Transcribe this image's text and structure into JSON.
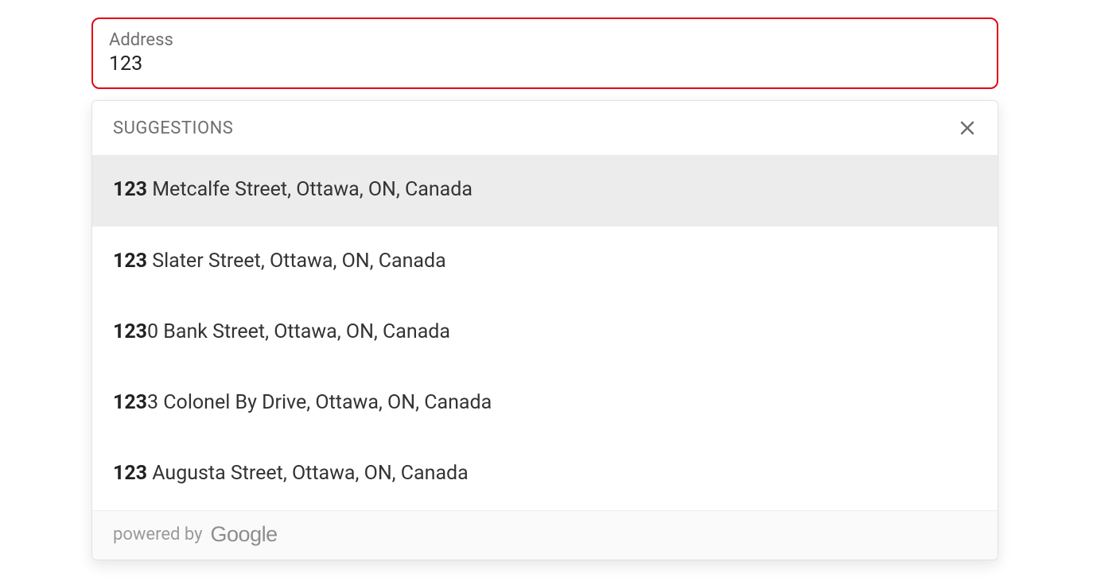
{
  "field": {
    "label": "Address",
    "value": "123"
  },
  "suggestions": {
    "header": "SUGGESTIONS",
    "items": [
      {
        "match": "123",
        "rest": " Metcalfe Street, Ottawa, ON, Canada",
        "highlighted": true
      },
      {
        "match": "123",
        "rest": " Slater Street, Ottawa, ON, Canada",
        "highlighted": false
      },
      {
        "match": "123",
        "rest": "0 Bank Street, Ottawa, ON, Canada",
        "highlighted": false
      },
      {
        "match": "123",
        "rest": "3 Colonel By Drive, Ottawa, ON, Canada",
        "highlighted": false
      },
      {
        "match": "123",
        "rest": " Augusta Street, Ottawa, ON, Canada",
        "highlighted": false
      }
    ]
  },
  "footer": {
    "powered_by": "powered by",
    "provider": "Google"
  },
  "colors": {
    "focus_border": "#e30613",
    "text_muted": "#6f6f6f",
    "highlight_bg": "#ececec"
  }
}
